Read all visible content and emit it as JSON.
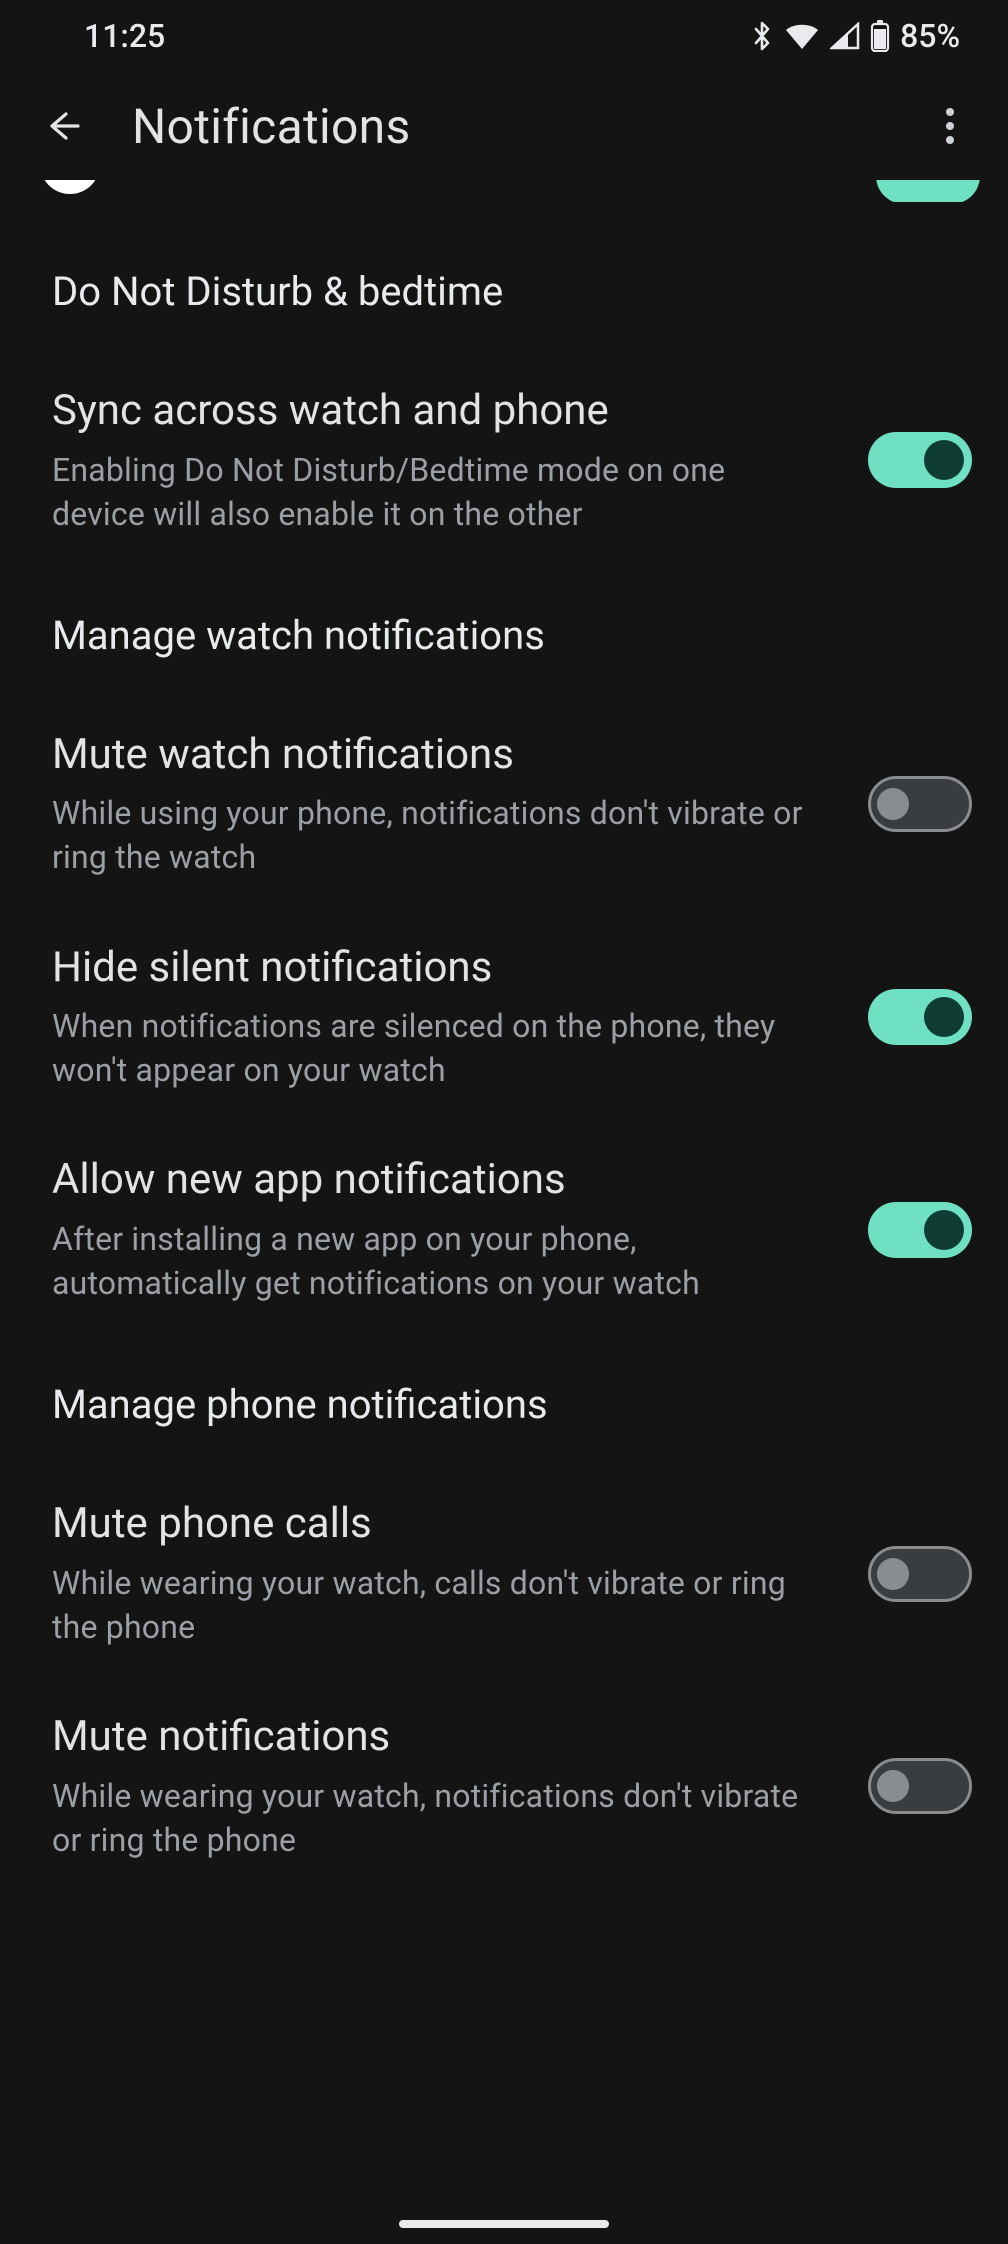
{
  "status": {
    "time": "11:25",
    "battery_text": "85%"
  },
  "header": {
    "title": "Notifications"
  },
  "sections": [
    {
      "title": "Do Not Disturb & bedtime",
      "items": [
        {
          "id": "sync-dnd",
          "label": "Sync across watch and phone",
          "desc": "Enabling Do Not Disturb/Bedtime mode on one device will also enable it on the other",
          "on": true
        }
      ]
    },
    {
      "title": "Manage watch notifications",
      "items": [
        {
          "id": "mute-watch",
          "label": "Mute watch notifications",
          "desc": "While using your phone, notifications don't vibrate or ring the watch",
          "on": false
        },
        {
          "id": "hide-silent",
          "label": "Hide silent notifications",
          "desc": "When notifications are silenced on the phone, they won't appear on your watch",
          "on": true
        },
        {
          "id": "allow-new",
          "label": "Allow new app notifications",
          "desc": "After installing a new app on your phone, automatically get notifications on your watch",
          "on": true
        }
      ]
    },
    {
      "title": "Manage phone notifications",
      "items": [
        {
          "id": "mute-calls",
          "label": "Mute phone calls",
          "desc": "While wearing your watch, calls don't vibrate or ring the phone",
          "on": false
        },
        {
          "id": "mute-notif",
          "label": "Mute notifications",
          "desc": "While wearing your watch, notifications don't vibrate or ring the phone",
          "on": false
        }
      ]
    }
  ]
}
